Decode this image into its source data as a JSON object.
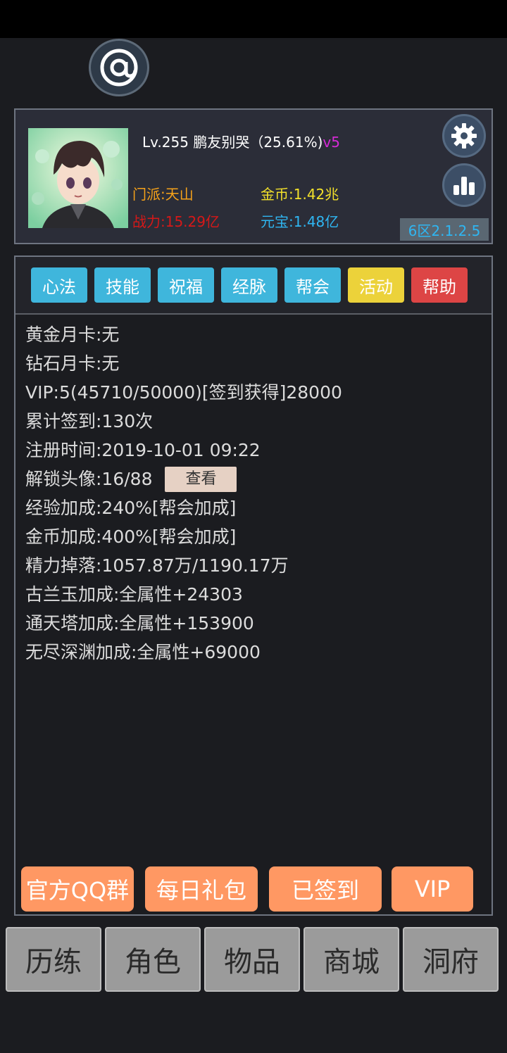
{
  "profile": {
    "level_name_line": "Lv.255 鹏友别哭（25.61%)",
    "vip_tag": "v5",
    "sect": "门派:天山",
    "power": "战力:15.29亿",
    "gold": "金币:1.42兆",
    "ingot": "元宝:1.48亿",
    "server": "6区2.1.2.5"
  },
  "tabs": [
    {
      "label": "心法",
      "color": "#3fb6dc"
    },
    {
      "label": "技能",
      "color": "#3fb6dc"
    },
    {
      "label": "祝福",
      "color": "#3fb6dc"
    },
    {
      "label": "经脉",
      "color": "#3fb6dc"
    },
    {
      "label": "帮会",
      "color": "#3fb6dc"
    },
    {
      "label": "活动",
      "color": "#ecd23a"
    },
    {
      "label": "帮助",
      "color": "#dd4545"
    }
  ],
  "info": {
    "gold_card": "黄金月卡:无",
    "diamond_card": "钻石月卡:无",
    "vip": "VIP:5(45710/50000)[签到获得]28000",
    "sign_total": "累计签到:130次",
    "register_time": "注册时间:2019-10-01 09:22",
    "avatars": "解锁头像:16/88",
    "view_label": "查看",
    "exp_bonus": "经验加成:240%[帮会加成]",
    "gold_bonus": "金币加成:400%[帮会加成]",
    "energy_drop": "精力掉落:1057.87万/1190.17万",
    "gulan_bonus": "古兰玉加成:全属性+24303",
    "tower_bonus": "通天塔加成:全属性+153900",
    "abyss_bonus": "无尽深渊加成:全属性+69000"
  },
  "actions": {
    "qq_group": "官方QQ群",
    "daily_gift": "每日礼包",
    "signed": "已签到",
    "vip": "VIP"
  },
  "nav": [
    "历练",
    "角色",
    "物品",
    "商城",
    "洞府"
  ],
  "icons": {
    "at": "at-sign-icon",
    "settings": "gear-icon",
    "stats": "bar-chart-icon"
  }
}
